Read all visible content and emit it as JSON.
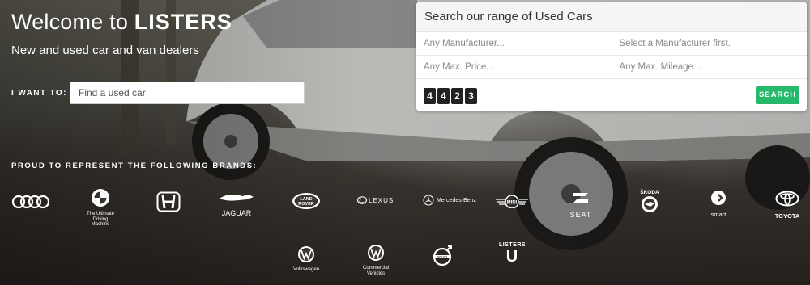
{
  "hero": {
    "title_prefix": "Welcome to",
    "title_brand": "LISTERS",
    "subtitle": "New and used car and van dealers",
    "want_label": "I WANT TO:",
    "want_value": "Find a used car"
  },
  "search_panel": {
    "title": "Search our range of Used Cars",
    "manufacturer": "Any Manufacturer...",
    "model": "Select a Manufacturer first.",
    "price": "Any Max. Price...",
    "mileage": "Any Max. Mileage...",
    "stock_count": [
      "4",
      "4",
      "2",
      "3"
    ],
    "search_label": "SEARCH"
  },
  "brands": {
    "label": "PROUD TO REPRESENT THE FOLLOWING BRANDS:",
    "bmw_tagline": "The Ultimate Driving Machine",
    "jaguar": "JAGUAR",
    "landrover_top": "LAND",
    "landrover_bottom": "ROVER",
    "lexus": "LEXUS",
    "mercedes": "Mercedes-Benz",
    "mini": "MINI",
    "seat": "SEAT",
    "skoda": "ŠKODA",
    "smart": "smart",
    "toyota": "TOYOTA",
    "vw": "Volkswagen",
    "vw_commercial": "Commercial Vehicles",
    "volvo": "VOLVO",
    "listers_top": "LISTERS",
    "listers_u": "U"
  },
  "colors": {
    "accent": "#26b96a",
    "digit_bg": "#222222"
  }
}
